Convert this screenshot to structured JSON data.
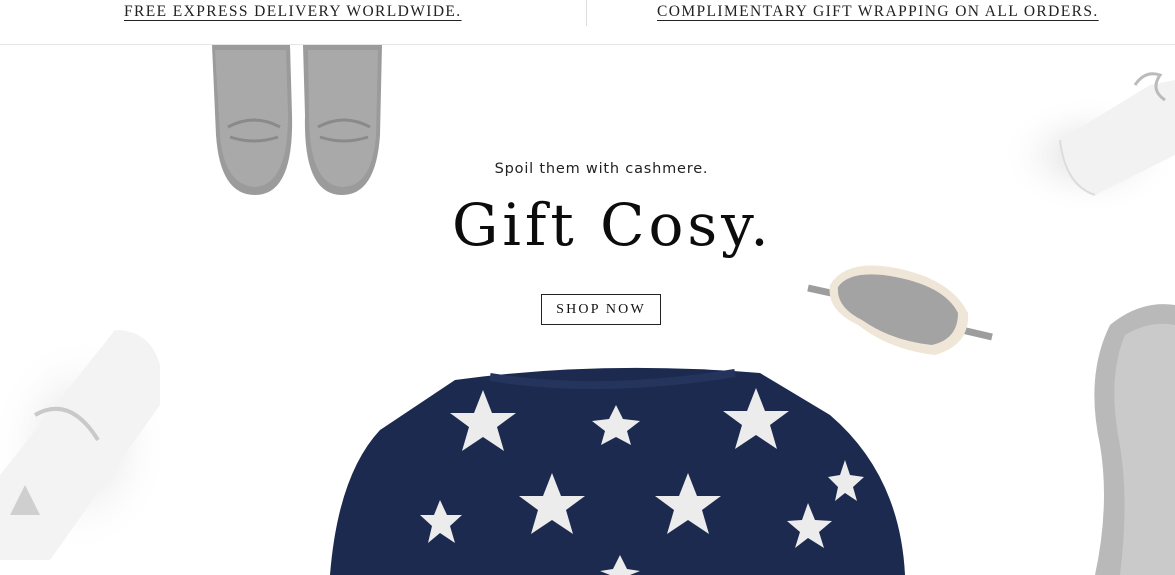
{
  "promo_bar": {
    "left_text": "FREE EXPRESS DELIVERY WORLDWIDE.",
    "right_text": "COMPLIMENTARY GIFT WRAPPING ON ALL ORDERS."
  },
  "hero": {
    "subtitle": "Spoil them with cashmere.",
    "headline": "Gift Cosy.",
    "cta_label": "SHOP NOW"
  },
  "colors": {
    "sweater_navy": "#1b2a4e",
    "cashmere_grey": "#a8a8a8",
    "background": "#ffffff"
  }
}
